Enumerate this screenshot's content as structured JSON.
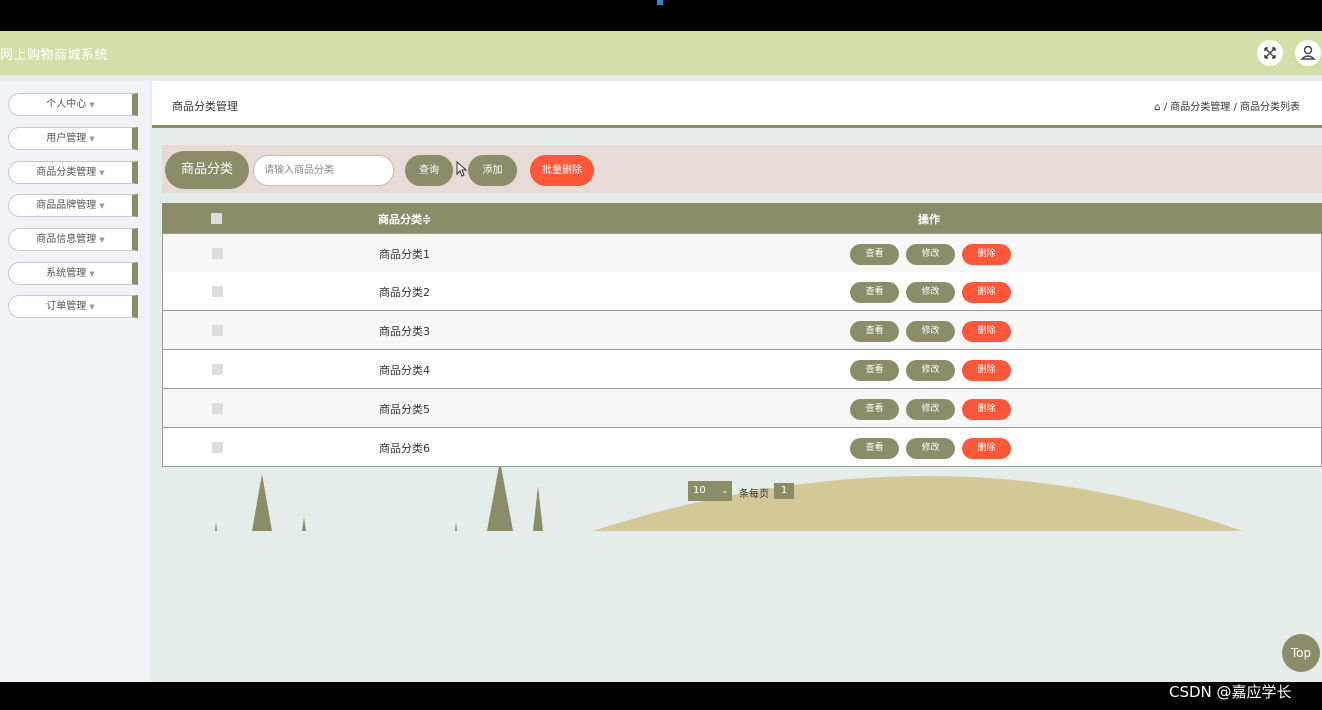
{
  "app": {
    "title": "网上购物商城系统"
  },
  "topbar_icons": [
    "fullscreen-icon",
    "user-icon"
  ],
  "sidebar": {
    "items": [
      {
        "label": "个人中心"
      },
      {
        "label": "用户管理"
      },
      {
        "label": "商品分类管理"
      },
      {
        "label": "商品品牌管理"
      },
      {
        "label": "商品信息管理"
      },
      {
        "label": "系统管理"
      },
      {
        "label": "订单管理"
      }
    ]
  },
  "header": {
    "title": "商品分类管理",
    "breadcrumb": "/ 商品分类管理 / 商品分类列表"
  },
  "toolbar": {
    "search_label": "商品分类",
    "search_placeholder": "请输入商品分类",
    "query_label": "查询",
    "add_label": "添加",
    "batch_delete_label": "批量删除"
  },
  "table": {
    "headers": {
      "category": "商品分类",
      "sort_icon": "≑",
      "actions": "操作"
    },
    "rows": [
      {
        "category": "商品分类1"
      },
      {
        "category": "商品分类2"
      },
      {
        "category": "商品分类3"
      },
      {
        "category": "商品分类4"
      },
      {
        "category": "商品分类5"
      },
      {
        "category": "商品分类6"
      }
    ],
    "actions": {
      "view": "查看",
      "edit": "修改",
      "delete": "删除"
    }
  },
  "pagination": {
    "page_size": "10",
    "per_page_label": "条每页",
    "current_page": "1"
  },
  "top_button": "Top",
  "watermark": "CSDN @嘉应学长",
  "colors": {
    "primary": "#8a8d68",
    "danger": "#fe5739",
    "topbar": "#d3dfa9",
    "toolbar_bg": "#e6dbd7",
    "hill": "#d5c898"
  }
}
